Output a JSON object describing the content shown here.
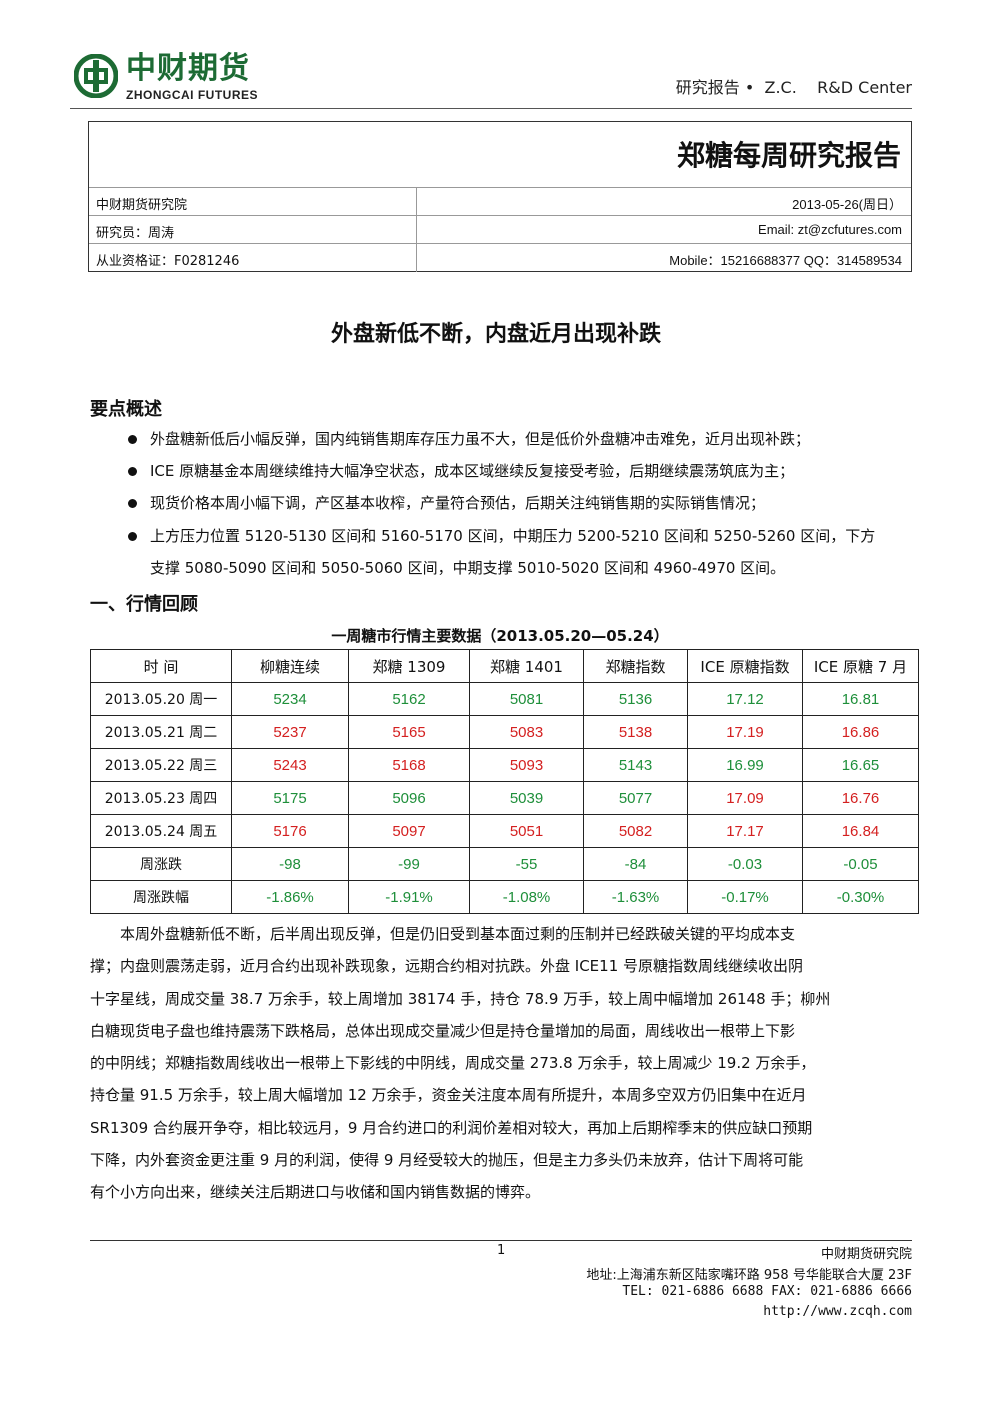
{
  "header": {
    "logo_cn": "中财期货",
    "logo_en": "ZHONGCAI FUTURES",
    "right_text": "研究报告 •  Z.C.    R&D Center"
  },
  "report": {
    "title": "郑糖每周研究报告",
    "institute": "中财期货研究院",
    "date": "2013-05-26(周日）",
    "researcher": "研究员：周涛",
    "email": "Email:  zt@zcfutures.com",
    "license": "从业资格证：F0281246",
    "contact": "Mobile：15216688377    QQ：314589534"
  },
  "headline": "外盘新低不断，内盘近月出现补跌",
  "summary": {
    "heading": "要点概述",
    "bullets": [
      "外盘糖新低后小幅反弹，国内纯销售期库存压力虽不大，但是低价外盘糖冲击难免，近月出现补跌；",
      "ICE 原糖基金本周继续维持大幅净空状态，成本区域继续反复接受考验，后期继续震荡筑底为主；",
      "现货价格本周小幅下调，产区基本收榨，产量符合预估，后期关注纯销售期的实际销售情况；",
      "上方压力位置 5120-5130 区间和 5160-5170 区间，中期压力 5200-5210 区间和 5250-5260 区间，下方"
    ],
    "bullet4_cont": "支撑 5080-5090 区间和 5050-5060 区间，中期支撑 5010-5020 区间和 4960-4970 区间。"
  },
  "section1": {
    "heading": "一、行情回顾",
    "table_title": "一周糖市行情主要数据（2013.05.20—05.24）",
    "columns": [
      "时  间",
      "柳糖连续",
      "郑糖 1309",
      "郑糖 1401",
      "郑糖指数",
      "ICE 原糖指数",
      "ICE 原糖 7 月"
    ],
    "rows": [
      {
        "label": "2013.05.20 周一",
        "values": [
          "5234",
          "5162",
          "5081",
          "5136",
          "17.12",
          "16.81"
        ],
        "colors": [
          "green",
          "green",
          "green",
          "green",
          "green",
          "green"
        ]
      },
      {
        "label": "2013.05.21 周二",
        "values": [
          "5237",
          "5165",
          "5083",
          "5138",
          "17.19",
          "16.86"
        ],
        "colors": [
          "red",
          "red",
          "red",
          "red",
          "red",
          "red"
        ]
      },
      {
        "label": "2013.05.22 周三",
        "values": [
          "5243",
          "5168",
          "5093",
          "5143",
          "16.99",
          "16.65"
        ],
        "colors": [
          "red",
          "red",
          "red",
          "green",
          "green",
          "green"
        ]
      },
      {
        "label": "2013.05.23 周四",
        "values": [
          "5175",
          "5096",
          "5039",
          "5077",
          "17.09",
          "16.76"
        ],
        "colors": [
          "green",
          "green",
          "green",
          "green",
          "red",
          "red"
        ]
      },
      {
        "label": "2013.05.24 周五",
        "values": [
          "5176",
          "5097",
          "5051",
          "5082",
          "17.17",
          "16.84"
        ],
        "colors": [
          "red",
          "red",
          "red",
          "red",
          "red",
          "red"
        ]
      },
      {
        "label": "周涨跌",
        "values": [
          "-98",
          "-99",
          "-55",
          "-84",
          "-0.03",
          "-0.05"
        ],
        "colors": [
          "green",
          "green",
          "green",
          "green",
          "green",
          "green"
        ]
      },
      {
        "label": "周涨跌幅",
        "values": [
          "-1.86%",
          "-1.91%",
          "-1.08%",
          "-1.63%",
          "-0.17%",
          "-0.30%"
        ],
        "colors": [
          "green",
          "green",
          "green",
          "green",
          "green",
          "green"
        ]
      }
    ],
    "paragraph_lines": [
      "　　本周外盘糖新低不断，后半周出现反弹，但是仍旧受到基本面过剩的压制并已经跌破关键的平均成本支",
      "撑；内盘则震荡走弱，近月合约出现补跌现象，远期合约相对抗跌。外盘 ICE11 号原糖指数周线继续收出阴",
      "十字星线，周成交量 38.7 万余手，较上周增加 38174 手，持仓 78.9 万手，较上周中幅增加 26148 手；柳州",
      "白糖现货电子盘也维持震荡下跌格局，总体出现成交量减少但是持仓量增加的局面，周线收出一根带上下影",
      "的中阴线；郑糖指数周线收出一根带上下影线的中阴线，周成交量 273.8 万余手，较上周减少 19.2 万余手，",
      "持仓量 91.5 万余手，较上周大幅增加 12 万余手，资金关注度本周有所提升，本周多空双方仍旧集中在近月",
      "SR1309 合约展开争夺，相比较远月，9 月合约进口的利润价差相对较大，再加上后期榨季末的供应缺口预期",
      "下降，内外套资金更注重 9 月的利润，使得 9 月经受较大的抛压，但是主力多头仍未放弃，估计下周将可能",
      "有个小方向出来，继续关注后期进口与收储和国内销售数据的博弈。"
    ]
  },
  "footer": {
    "page": "1",
    "institute": "中财期货研究院",
    "address": "地址:上海浦东新区陆家嘴环路 958 号华能联合大厦 23F",
    "tel": "TEL: 021-6886 6688 FAX: 021-6886 6666",
    "url": "http://www.zcqh.com"
  },
  "colors": {
    "brand_green": "#1d6b34",
    "up_red": "#d42020",
    "down_green": "#1e8f3a"
  }
}
